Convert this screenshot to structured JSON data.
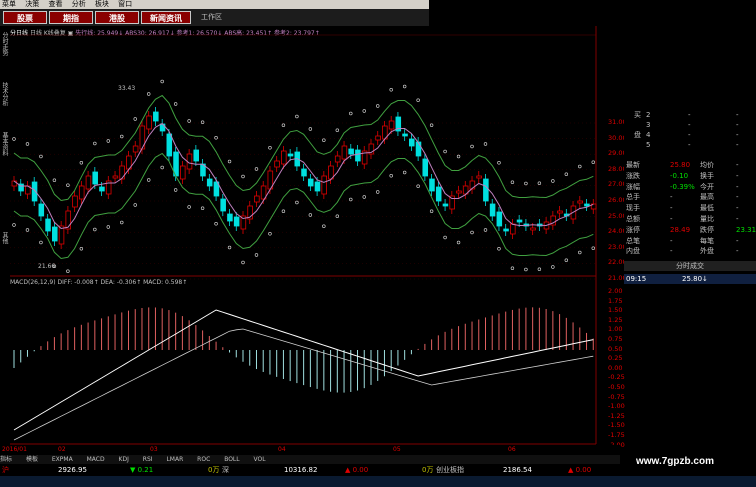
{
  "menubar": [
    "菜单",
    "决策",
    "查看",
    "分析",
    "板块",
    "窗口"
  ],
  "topbar": {
    "buttons": [
      {
        "label": "股票"
      },
      {
        "label": "期指"
      },
      {
        "label": "港股"
      },
      {
        "label": "新闻资讯"
      }
    ],
    "workarea": "工作区"
  },
  "sidetabs": [
    "分时走势",
    "技术分析",
    "基本资料",
    "其他"
  ],
  "chart_info": {
    "period": "分日线",
    "tabs": "日线 K线叠复 ▣",
    "ma_values": "先行线: 25.949↓  ABS30: 26.917↓  参考1: 26.570↓  ABS高: 23.451↑  参考2: 23.797↑"
  },
  "macd_info": "MACD(26,12,9)  DIFF: -0.008↑  DEA: -0.306↑  MACD: 0.598↑",
  "price_axis": [
    "31.00",
    "30.00",
    "29.00",
    "28.00",
    "27.00",
    "26.00",
    "25.00",
    "24.00",
    "23.00",
    "22.00",
    "21.00"
  ],
  "macd_axis": [
    "2.00",
    "1.75",
    "1.50",
    "1.25",
    "1.00",
    "0.75",
    "0.50",
    "0.25",
    "0.00",
    "-0.25",
    "-0.50",
    "-0.75",
    "-1.00",
    "-1.25",
    "-1.50",
    "-1.75",
    "-2.00"
  ],
  "annotations": {
    "high": "33.43",
    "low": "21.66"
  },
  "date_labels": [
    "2016/01",
    "02",
    "03",
    "04",
    "05",
    "06"
  ],
  "rightpanel": {
    "order_book": [
      {
        "side": "买",
        "level": "2",
        "price": "-",
        "vol": "-"
      },
      {
        "side": "",
        "level": "3",
        "price": "-",
        "vol": "-"
      },
      {
        "side": "盘",
        "level": "4",
        "price": "-",
        "vol": "-"
      },
      {
        "side": "",
        "level": "5",
        "price": "-",
        "vol": "-"
      }
    ],
    "stats": [
      {
        "l": "最新",
        "v": "25.80",
        "l2": "均价",
        "v2": "-"
      },
      {
        "l": "涨跌",
        "v": "-0.10",
        "l2": "换手",
        "v2": "-"
      },
      {
        "l": "涨幅",
        "v": "-0.39%",
        "l2": "今开",
        "v2": "-"
      },
      {
        "l": "总手",
        "v": "-",
        "l2": "最高",
        "v2": "-"
      },
      {
        "l": "现手",
        "v": "-",
        "l2": "最低",
        "v2": "-"
      },
      {
        "l": "总额",
        "v": "-",
        "l2": "量比",
        "v2": "-"
      },
      {
        "l": "涨停",
        "v": "28.49",
        "l2": "跌停",
        "v2": "23.31"
      },
      {
        "l": "总笔",
        "v": "-",
        "l2": "每笔",
        "v2": "-"
      },
      {
        "l": "内盘",
        "v": "-",
        "l2": "外盘",
        "v2": "-"
      }
    ],
    "ticks_title": "分时成交",
    "tick": {
      "time": "09:15",
      "price": "25.80↓"
    }
  },
  "bottom_tabs": [
    "指标",
    "模板",
    "EXPMA",
    "MACD",
    "KDJ",
    "RSI",
    "LMAR",
    "ROC",
    "BOLL",
    "VOL"
  ],
  "status": {
    "sh_label": "沪",
    "sh_index": "2926.95",
    "sh_change": "▼ 0.21",
    "sh_amount": "0万",
    "sz_label": "深",
    "sz_index": "10316.82",
    "sz_change": "▲ 0.00",
    "cy_amount": "0万",
    "cy_label": "创业板指",
    "cy_index": "2186.54",
    "cy_change": "▲ 0.00"
  },
  "watermark": "www.7gpzb.com",
  "colors": {
    "up": "#e00000",
    "down": "#00e0e0",
    "ma": "#c080c0",
    "band": "#40a040"
  }
}
